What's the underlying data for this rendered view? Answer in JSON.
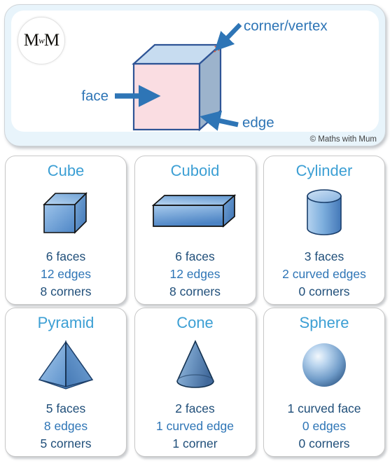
{
  "header": {
    "logo_main": "M",
    "logo_small": "w",
    "logo_end": "M",
    "logo_alt": "Maths with Mum monogram",
    "copyright": "© Maths with Mum",
    "labels": {
      "vertex": "corner/vertex",
      "face": "face",
      "edge": "edge"
    },
    "colors": {
      "panel_frame": "#e8f4fb",
      "label_blue": "#2e75b6",
      "cube_front": "#fadde2",
      "cube_top": "#c7dcf0",
      "cube_side": "#9cb3cc",
      "cube_outline": "#2e5496",
      "vertex_marker": "#e8502a"
    }
  },
  "cards": [
    {
      "name": "Cube",
      "shape": "cube-icon",
      "stats": [
        "6 faces",
        "12 edges",
        "8 corners"
      ]
    },
    {
      "name": "Cuboid",
      "shape": "cuboid-icon",
      "stats": [
        "6 faces",
        "12 edges",
        "8 corners"
      ]
    },
    {
      "name": "Cylinder",
      "shape": "cylinder-icon",
      "stats": [
        "3 faces",
        "2 curved edges",
        "0 corners"
      ]
    },
    {
      "name": "Pyramid",
      "shape": "pyramid-icon",
      "stats": [
        "5 faces",
        "8 edges",
        "5 corners"
      ]
    },
    {
      "name": "Cone",
      "shape": "cone-icon",
      "stats": [
        "2 faces",
        "1 curved edge",
        "1 corner"
      ]
    },
    {
      "name": "Sphere",
      "shape": "sphere-icon",
      "stats": [
        "1 curved face",
        "0 edges",
        "0 corners"
      ]
    }
  ],
  "theme": {
    "title_color": "#3c9fd4",
    "stat_dark": "#1f4e79",
    "stat_mid": "#2e75b6",
    "shape_blue_light": "#bdd7ee",
    "shape_blue_mid": "#6fa8dc",
    "shape_blue_dark": "#4a7ebb"
  }
}
